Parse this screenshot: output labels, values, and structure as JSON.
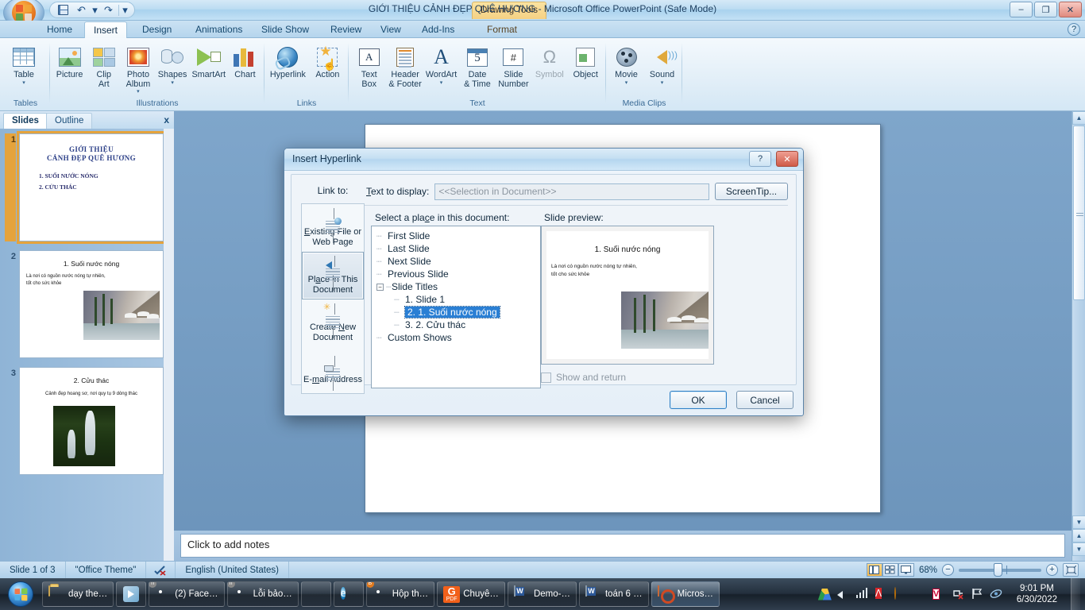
{
  "window": {
    "title": "GIỚI THIỆU CẢNH ĐẸP QUÊ HƯƠNG - Microsoft Office PowerPoint (Safe Mode)",
    "contextual_tab": "Drawing Tools",
    "minimize": "–",
    "restore": "❐",
    "close": "✕",
    "help": "?"
  },
  "quick_access": {
    "save": "save-icon",
    "undo": "↶",
    "undo_caret": "▾",
    "redo": "↷",
    "customize": "▾"
  },
  "ribbon": {
    "tabs": [
      {
        "label": "Home",
        "active": false
      },
      {
        "label": "Insert",
        "active": true
      },
      {
        "label": "Design",
        "active": false
      },
      {
        "label": "Animations",
        "active": false
      },
      {
        "label": "Slide Show",
        "active": false
      },
      {
        "label": "Review",
        "active": false
      },
      {
        "label": "View",
        "active": false
      },
      {
        "label": "Add-Ins",
        "active": false
      },
      {
        "label": "Format",
        "active": false
      }
    ],
    "groups": [
      {
        "label": "Tables",
        "items": [
          {
            "label": "Table",
            "caret": "▾"
          }
        ]
      },
      {
        "label": "Illustrations",
        "items": [
          {
            "label": "Picture",
            "caret": ""
          },
          {
            "label": "Clip\nArt",
            "caret": ""
          },
          {
            "label": "Photo\nAlbum",
            "caret": "▾"
          },
          {
            "label": "Shapes",
            "caret": "▾"
          },
          {
            "label": "SmartArt",
            "caret": ""
          },
          {
            "label": "Chart",
            "caret": ""
          }
        ]
      },
      {
        "label": "Links",
        "items": [
          {
            "label": "Hyperlink",
            "caret": ""
          },
          {
            "label": "Action",
            "caret": ""
          }
        ]
      },
      {
        "label": "Text",
        "items": [
          {
            "label": "Text\nBox",
            "caret": ""
          },
          {
            "label": "Header\n& Footer",
            "caret": ""
          },
          {
            "label": "WordArt",
            "caret": "▾"
          },
          {
            "label": "Date\n& Time",
            "caret": ""
          },
          {
            "label": "Slide\nNumber",
            "caret": ""
          },
          {
            "label": "Symbol",
            "caret": ""
          },
          {
            "label": "Object",
            "caret": ""
          }
        ]
      },
      {
        "label": "Media Clips",
        "items": [
          {
            "label": "Movie",
            "caret": "▾"
          },
          {
            "label": "Sound",
            "caret": "▾"
          }
        ]
      }
    ]
  },
  "left_pane": {
    "tabs": [
      {
        "label": "Slides",
        "active": true
      },
      {
        "label": "Outline",
        "active": false
      }
    ],
    "close": "x",
    "slides": [
      {
        "number": "1",
        "selected": true,
        "title_line1": "GIỚI THIỆU",
        "title_line2": "CẢNH ĐẸP QUÊ HƯƠNG",
        "bullets": [
          "1. SUỐI NƯỚC NÓNG",
          "2. CỬU THÁC"
        ]
      },
      {
        "number": "2",
        "selected": false,
        "title": "1. Suối nước nóng",
        "body_line1": "Là nơi có nguồn nước nóng tự nhiên,",
        "body_line2": " tốt cho sức khỏe",
        "image": "hot-spring-photo"
      },
      {
        "number": "3",
        "selected": false,
        "title": "2. Cửu thác",
        "body_line1": "Cảnh đẹp hoang sơ, nơi quy tụ 9 dòng thác",
        "image": "waterfall-photo"
      }
    ]
  },
  "notes": {
    "placeholder": "Click to add notes"
  },
  "status_bar": {
    "slide_counter": "Slide 1 of 3",
    "theme": "\"Office Theme\"",
    "language": "English (United States)",
    "spellcheck_icon": "spellcheck-icon",
    "zoom_percent": "68%",
    "zoom_out": "−",
    "zoom_in": "+",
    "views": [
      "normal-view-icon",
      "slide-sorter-icon",
      "slide-show-icon"
    ],
    "fit_window_icon": "fit-slide-to-window-icon"
  },
  "dialog": {
    "title": "Insert Hyperlink",
    "help_btn": "?",
    "close_btn": "✕",
    "link_to_label": "Link to:",
    "text_to_display_label": "Text to display:",
    "text_to_display_value": "<<Selection in Document>>",
    "screentip_button": "ScreenTip...",
    "link_to_items": [
      {
        "label_line1": "Existing File or",
        "label_line2": "Web Page",
        "selected": false,
        "icon": "existing-file-icon"
      },
      {
        "label_line1": "Place in This",
        "label_line2": "Document",
        "selected": true,
        "icon": "place-in-document-icon"
      },
      {
        "label_line1": "Create New",
        "label_line2": "Document",
        "selected": false,
        "icon": "create-new-document-icon"
      },
      {
        "label_line1": "E-mail Address",
        "label_line2": "",
        "selected": false,
        "icon": "email-address-icon"
      }
    ],
    "select_place_label": "Select a place in this document:",
    "tree": [
      {
        "label": "First Slide",
        "level": 1,
        "selected": false,
        "expander": ""
      },
      {
        "label": "Last Slide",
        "level": 1,
        "selected": false,
        "expander": ""
      },
      {
        "label": "Next Slide",
        "level": 1,
        "selected": false,
        "expander": ""
      },
      {
        "label": "Previous Slide",
        "level": 1,
        "selected": false,
        "expander": ""
      },
      {
        "label": "Slide Titles",
        "level": 1,
        "selected": false,
        "expander": "−"
      },
      {
        "label": "1. Slide 1",
        "level": 2,
        "selected": false,
        "expander": ""
      },
      {
        "label": "2. 1. Suối nước nóng",
        "level": 2,
        "selected": true,
        "expander": ""
      },
      {
        "label": "3. 2. Cửu thác",
        "level": 2,
        "selected": false,
        "expander": ""
      },
      {
        "label": "Custom Shows",
        "level": 1,
        "selected": false,
        "expander": ""
      }
    ],
    "slide_preview_label": "Slide preview:",
    "preview": {
      "title": "1. Suối nước nóng",
      "body_line1": "Là nơi có nguồn nước nóng tự nhiên,",
      "body_line2": " tốt cho sức khỏe",
      "image": "hot-spring-photo"
    },
    "show_and_return_label": "Show and return",
    "ok_button": "OK",
    "cancel_button": "Cancel"
  },
  "taskbar": {
    "start": "start-orb",
    "buttons": [
      {
        "label": "dạy the…",
        "icon": "folder-icon",
        "active": false
      },
      {
        "label": "",
        "icon": "windows-media-player-icon",
        "active": false
      },
      {
        "label": "(2) Face…",
        "icon": "chrome-icon",
        "badge": "h",
        "active": false
      },
      {
        "label": "Lỗi bảo…",
        "icon": "chrome-icon",
        "badge": "h",
        "active": false
      },
      {
        "label": "",
        "icon": "firefox-icon",
        "active": false
      },
      {
        "label": "",
        "icon": "internet-explorer-icon",
        "active": false
      },
      {
        "label": "Hộp th…",
        "icon": "chrome-icon",
        "badge": "B",
        "active": false
      },
      {
        "label": "Chuyê…",
        "icon": "pdf-icon",
        "active": false
      },
      {
        "label": "Demo-…",
        "icon": "word-icon",
        "active": false
      },
      {
        "label": "toán 6 …",
        "icon": "word-icon",
        "active": false
      },
      {
        "label": "Micros…",
        "icon": "powerpoint-icon",
        "active": true
      }
    ],
    "tray": [
      "google-drive-icon",
      "volume-icon",
      "network-icon",
      "avira-icon",
      "coin-icon",
      "ccleaner-icon",
      "unikey-icon",
      "safely-remove-icon",
      "action-center-flag-icon",
      "misc-icon"
    ],
    "clock_time": "9:01 PM",
    "clock_date": "6/30/2022"
  }
}
